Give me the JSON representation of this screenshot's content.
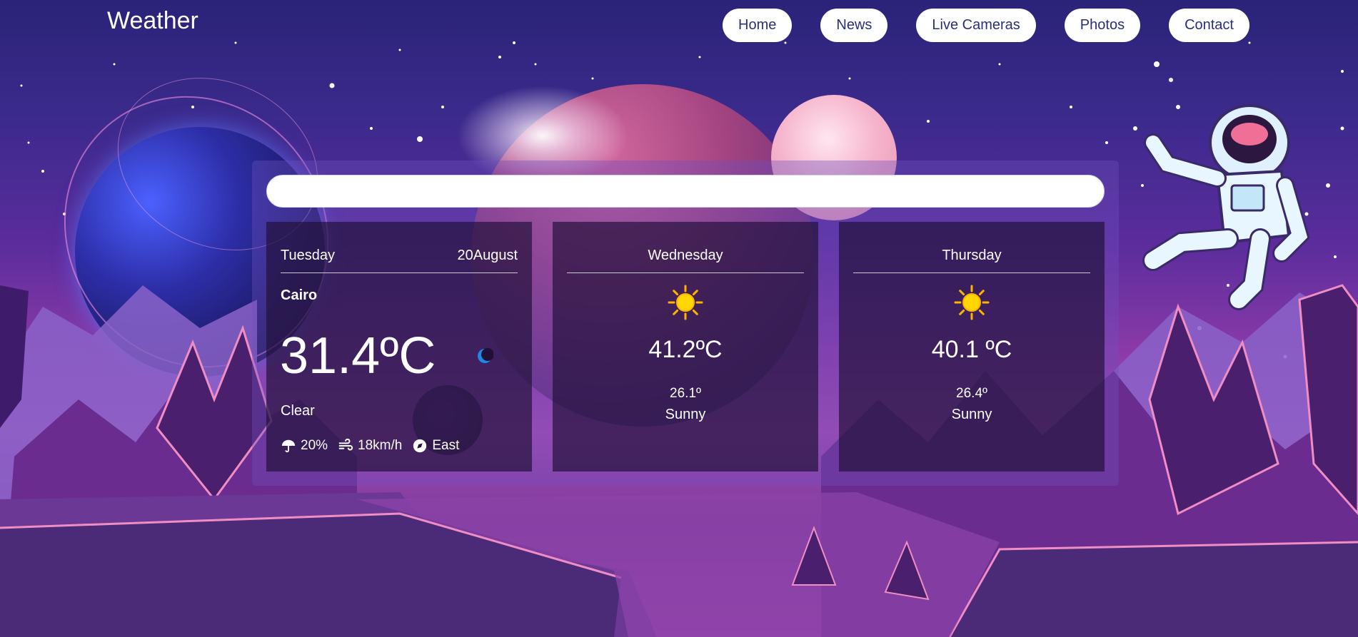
{
  "header": {
    "brand": "Weather",
    "nav": [
      "Home",
      "News",
      "Live Cameras",
      "Photos",
      "Contact"
    ]
  },
  "search": {
    "placeholder": "",
    "value": ""
  },
  "today": {
    "day": "Tuesday",
    "date": "20August",
    "city": "Cairo",
    "temp": "31.4ºC",
    "icon": "moon-icon",
    "condition": "Clear",
    "rain": "20%",
    "wind_speed": "18km/h",
    "wind_dir": "East"
  },
  "forecast": [
    {
      "day": "Wednesday",
      "icon": "sun-icon",
      "temp": "41.2ºC",
      "low": "26.1º",
      "condition": "Sunny"
    },
    {
      "day": "Thursday",
      "icon": "sun-icon",
      "temp": "40.1 ºC",
      "low": "26.4º",
      "condition": "Sunny"
    }
  ],
  "colors": {
    "nav_bg": "#ffffff",
    "nav_text": "#2a2f7a",
    "card_bg": "#201038",
    "accent_sun": "#ffc107"
  }
}
